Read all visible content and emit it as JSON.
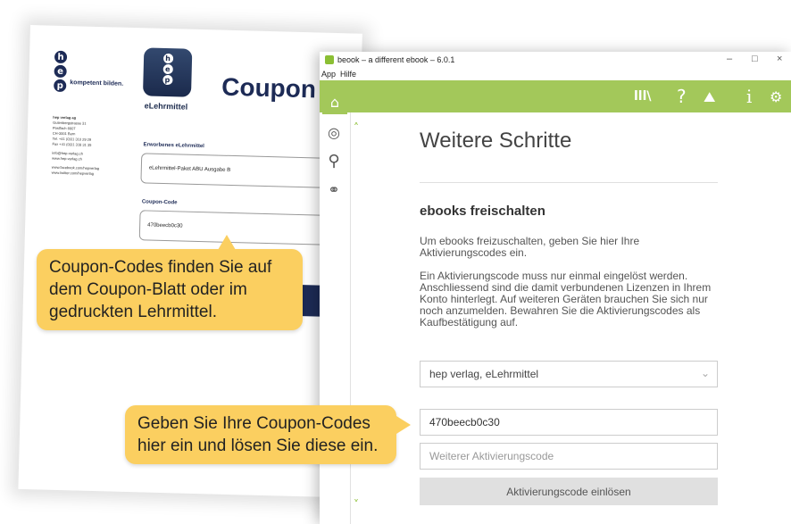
{
  "sheet": {
    "logo_letters": [
      "h",
      "e",
      "p"
    ],
    "tagline": "kompetent bilden.",
    "app_icon_letters": [
      "h",
      "e",
      "p"
    ],
    "app_icon_caption": "eLehrmittel",
    "title": "Coupon",
    "address_lines": [
      "hep verlag ag",
      "Gutenbergstrasse 31",
      "Postfach 6607",
      "CH-3001 Bern",
      "Tel. +41 (0)31 310 29 29",
      "Fax +41 (0)31 318 31 35",
      "",
      "info@hep-verlag.ch",
      "www.hep-verlag.ch",
      "",
      "www.facebook.com/hepverlag",
      "www.twitter.com/hepverlag"
    ],
    "purchased_label": "Erworbenes eLehrmittel",
    "purchased_value": "eLehrmittel-Paket ABU Ausgabe B",
    "coupon_label": "Coupon-Code",
    "coupon_value": "470beecb0c30"
  },
  "window": {
    "title": "beook – a different ebook – 6.0.1",
    "controls": {
      "minimize": "–",
      "maximize": "□",
      "close": "×"
    },
    "menu": [
      "App",
      "Hilfe"
    ],
    "toolbar_icons": [
      "library-icon",
      "help-icon",
      "mountain-icon",
      "info-icon",
      "settings-icon"
    ],
    "toolbar_glyphs": {
      "library": "lll\\",
      "help": "?",
      "mountain": "⛰",
      "info": "i",
      "settings": "⚙"
    },
    "sidebar_icons": [
      {
        "name": "shop-icon",
        "glyph": "⌂",
        "active": true
      },
      {
        "name": "globe-icon",
        "glyph": "◎",
        "active": false
      },
      {
        "name": "search-icon",
        "glyph": "⚲",
        "active": false
      },
      {
        "name": "share-icon",
        "glyph": "⚭",
        "active": false
      }
    ],
    "chevron_up": "˄",
    "chevron_down": "˅"
  },
  "content": {
    "heading": "Weitere Schritte",
    "subheading": "ebooks freischalten",
    "para1": "Um ebooks freizuschalten, geben Sie hier Ihre Aktivierungscodes ein.",
    "para2": "Ein Aktivierungscode muss nur einmal eingelöst werden. Anschliessend sind die damit verbundenen Lizenzen in Ihrem Konto hinterlegt. Auf weiteren Geräten brauchen Sie sich nur noch anzumelden. Bewahren Sie die Aktivierungscodes als Kaufbestätigung auf.",
    "publisher_select": "hep verlag, eLehrmittel",
    "code1_value": "470beecb0c30",
    "code2_placeholder": "Weiterer Aktivierungscode",
    "redeem_button": "Aktivierungscode einlösen"
  },
  "callouts": {
    "top": "Coupon-Codes finden Sie auf dem Coupon-Blatt oder im gedruckten Lehrmittel.",
    "bottom": "Geben Sie Ihre Coupon-Codes hier ein und lösen Sie diese ein."
  },
  "colors": {
    "accent_green": "#a3c85a",
    "callout_yellow": "#fbcf60",
    "hep_navy": "#1d2b56"
  }
}
